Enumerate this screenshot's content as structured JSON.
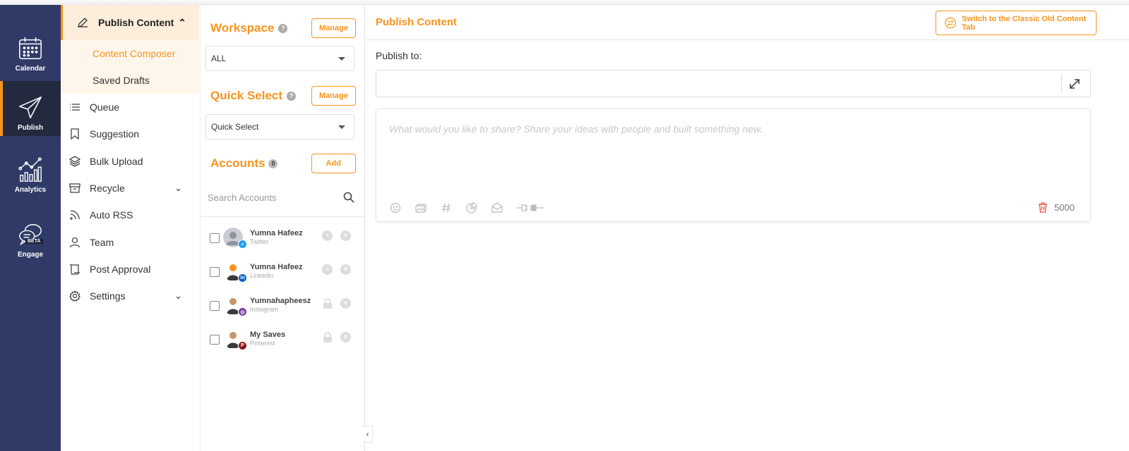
{
  "rail": {
    "items": [
      {
        "label": "Calendar",
        "icon": "calendar-icon"
      },
      {
        "label": "Publish",
        "icon": "paper-plane-icon",
        "active": true
      },
      {
        "label": "Analytics",
        "icon": "analytics-icon"
      },
      {
        "label": "Engage",
        "icon": "chat-bubbles-icon",
        "badge": "BETA"
      }
    ],
    "color": "#2f3a66",
    "accent": "#f7941d"
  },
  "menu": {
    "group": {
      "label": "Publish Content",
      "subitems": [
        {
          "label": "Content Composer",
          "active": true
        },
        {
          "label": "Saved Drafts"
        }
      ]
    },
    "items": [
      {
        "label": "Queue",
        "icon": "list-icon"
      },
      {
        "label": "Suggestion",
        "icon": "bookmark-icon"
      },
      {
        "label": "Bulk Upload",
        "icon": "layers-icon"
      },
      {
        "label": "Recycle",
        "icon": "archive-icon",
        "expandable": true
      },
      {
        "label": "Auto RSS",
        "icon": "rss-icon"
      },
      {
        "label": "Team",
        "icon": "user-icon"
      },
      {
        "label": "Post Approval",
        "icon": "scroll-icon"
      },
      {
        "label": "Settings",
        "icon": "gear-icon",
        "expandable": true
      }
    ]
  },
  "accounts_panel": {
    "workspace": {
      "title": "Workspace",
      "manage_label": "Manage",
      "selected": "ALL"
    },
    "quick_select": {
      "title": "Quick Select",
      "manage_label": "Manage",
      "placeholder": "Quick Select"
    },
    "accounts": {
      "title": "Accounts",
      "count": "0",
      "add_label": "Add",
      "search_placeholder": "Search Accounts"
    },
    "list": [
      {
        "name": "Yumna Hafeez",
        "platform": "Twitter",
        "badge": "t",
        "badge_color": "#1da1f2",
        "status": "clock"
      },
      {
        "name": "Yumna Hafeez",
        "platform": "Linkedin",
        "badge": "in",
        "badge_color": "#0a66c2",
        "status": "clock"
      },
      {
        "name": "Yumnahapheesz",
        "platform": "Instagram",
        "badge": "ig",
        "badge_color": "#7b3fa0",
        "status": "lock"
      },
      {
        "name": "My Saves",
        "platform": "Pinterest",
        "badge": "p",
        "badge_color": "#8b1a1a",
        "status": "lock"
      }
    ]
  },
  "main": {
    "title": "Publish Content",
    "classic_button": "Switch to the Classic Old Content Tab",
    "publish_to_label": "Publish to:",
    "composer_placeholder": "What would you like to share? Share your ideas with people and built something new.",
    "char_count": "5000"
  }
}
